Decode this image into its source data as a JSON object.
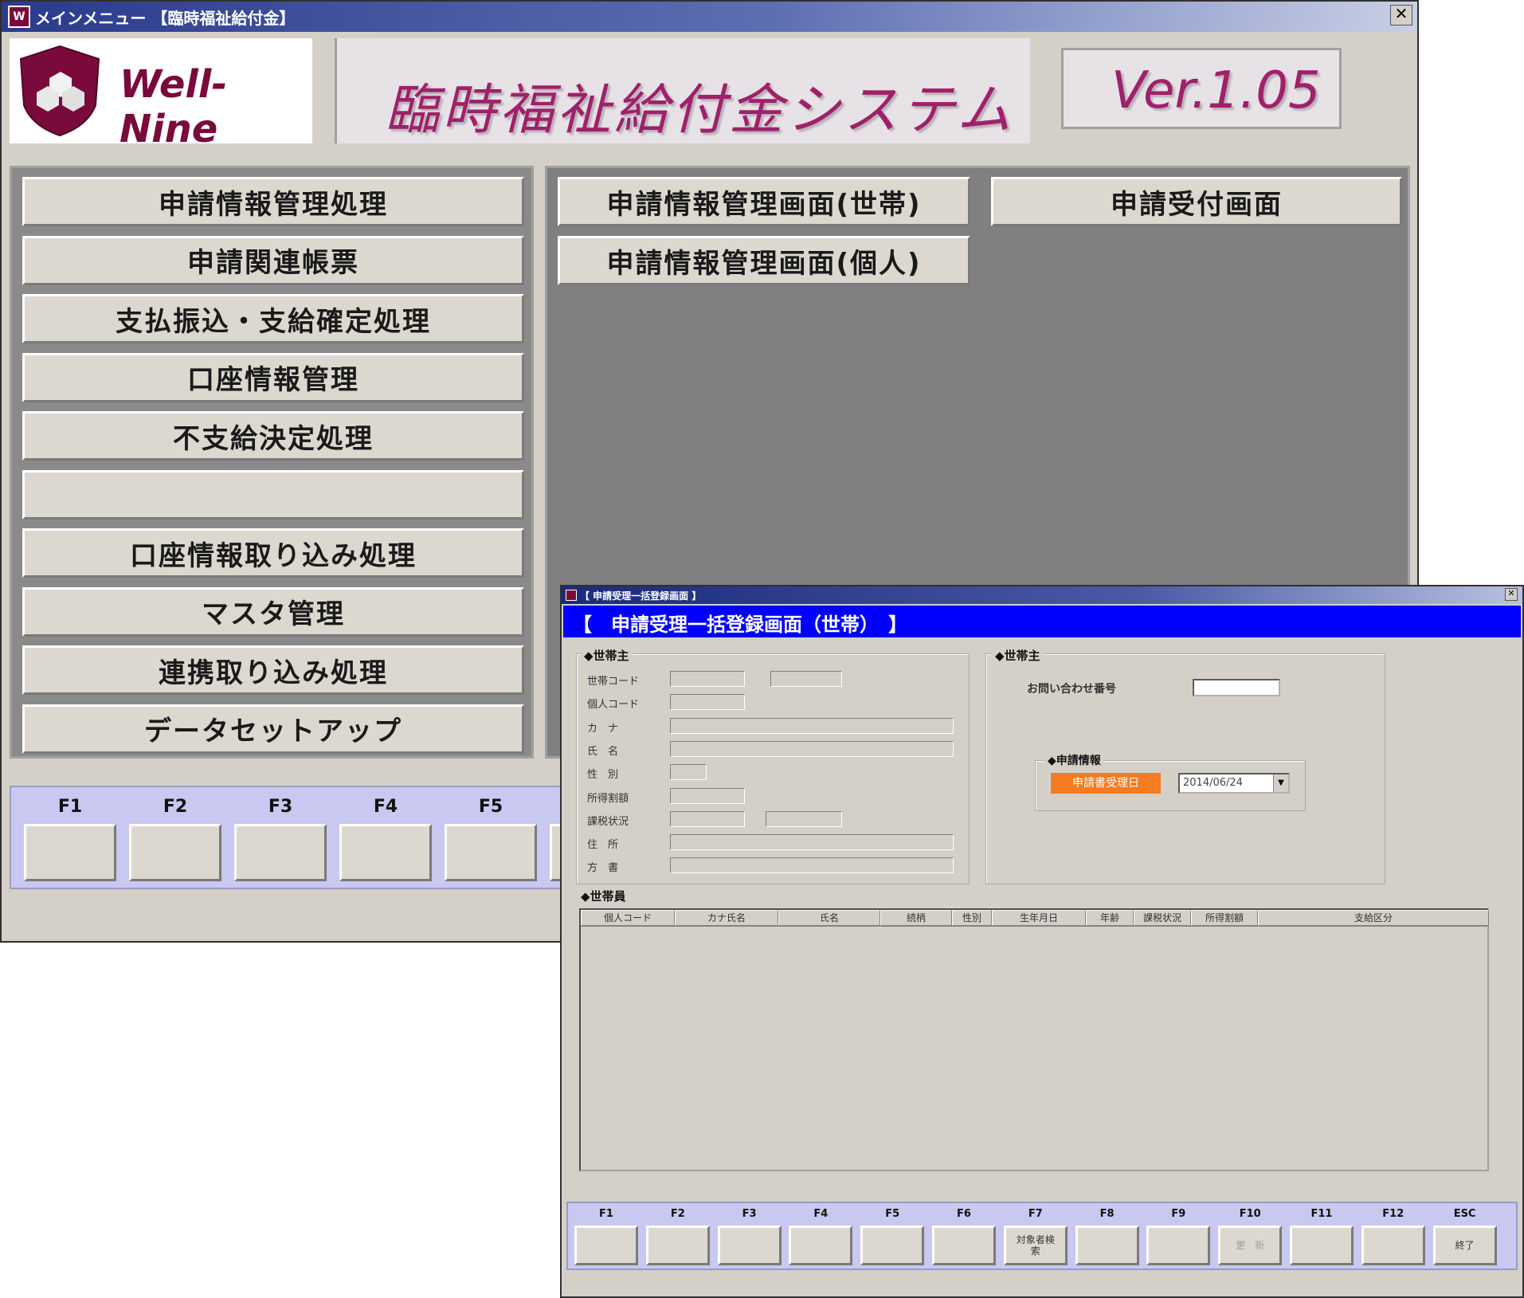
{
  "main_window": {
    "title": "メインメニュー 【臨時福祉給付金】",
    "logo_text": "Well-Nine",
    "system_title": "臨時福祉給付金システム",
    "version": "Ver.1.05",
    "left_menu": [
      "申請情報管理処理",
      "申請関連帳票",
      "支払振込・支給確定処理",
      "口座情報管理",
      "不支給決定処理",
      "",
      "口座情報取り込み処理",
      "マスタ管理",
      "連携取り込み処理",
      "データセットアップ"
    ],
    "right_menu": {
      "household": "申請情報管理画面(世帯)",
      "individual": "申請情報管理画面(個人)",
      "reception": "申請受付画面"
    },
    "fkeys": [
      "F1",
      "F2",
      "F3",
      "F4",
      "F5"
    ]
  },
  "sub_window": {
    "title": "【 申請受理一括登録画面 】",
    "header": "【　申請受理一括登録画面（世帯）　】",
    "left_group": {
      "title": "◆世帯主",
      "labels": [
        "世帯コード",
        "個人コード",
        "カ　ナ",
        "氏　名",
        "性　別",
        "所得割額",
        "課税状況",
        "住　所",
        "方　書"
      ]
    },
    "right_group": {
      "title": "◆世帯主",
      "inquiry_label": "お問い合わせ番号",
      "inquiry_value": "",
      "info_title": "◆申請情報",
      "date_label": "申請書受理日",
      "date_value": "2014/06/24"
    },
    "members": {
      "title": "◆世帯員",
      "columns": [
        "個人コード",
        "カナ氏名",
        "氏名",
        "続柄",
        "性別",
        "生年月日",
        "年齢",
        "課税状況",
        "所得割額",
        "支給区分"
      ]
    },
    "fkeys": [
      {
        "key": "F1",
        "label": ""
      },
      {
        "key": "F2",
        "label": ""
      },
      {
        "key": "F3",
        "label": ""
      },
      {
        "key": "F4",
        "label": ""
      },
      {
        "key": "F5",
        "label": ""
      },
      {
        "key": "F6",
        "label": ""
      },
      {
        "key": "F7",
        "label": "対象者検索"
      },
      {
        "key": "F8",
        "label": ""
      },
      {
        "key": "F9",
        "label": ""
      },
      {
        "key": "F10",
        "label": "更　新"
      },
      {
        "key": "F11",
        "label": ""
      },
      {
        "key": "F12",
        "label": ""
      },
      {
        "key": "ESC",
        "label": "終了"
      }
    ]
  },
  "colors": {
    "window_bg": "#d4d0c8",
    "panel_dark": "#808080",
    "fkey_bar": "#c8c8f0",
    "title_blue": "#0000ff",
    "brand": "#7a0a3c",
    "date_label_bg": "#f47b20"
  }
}
